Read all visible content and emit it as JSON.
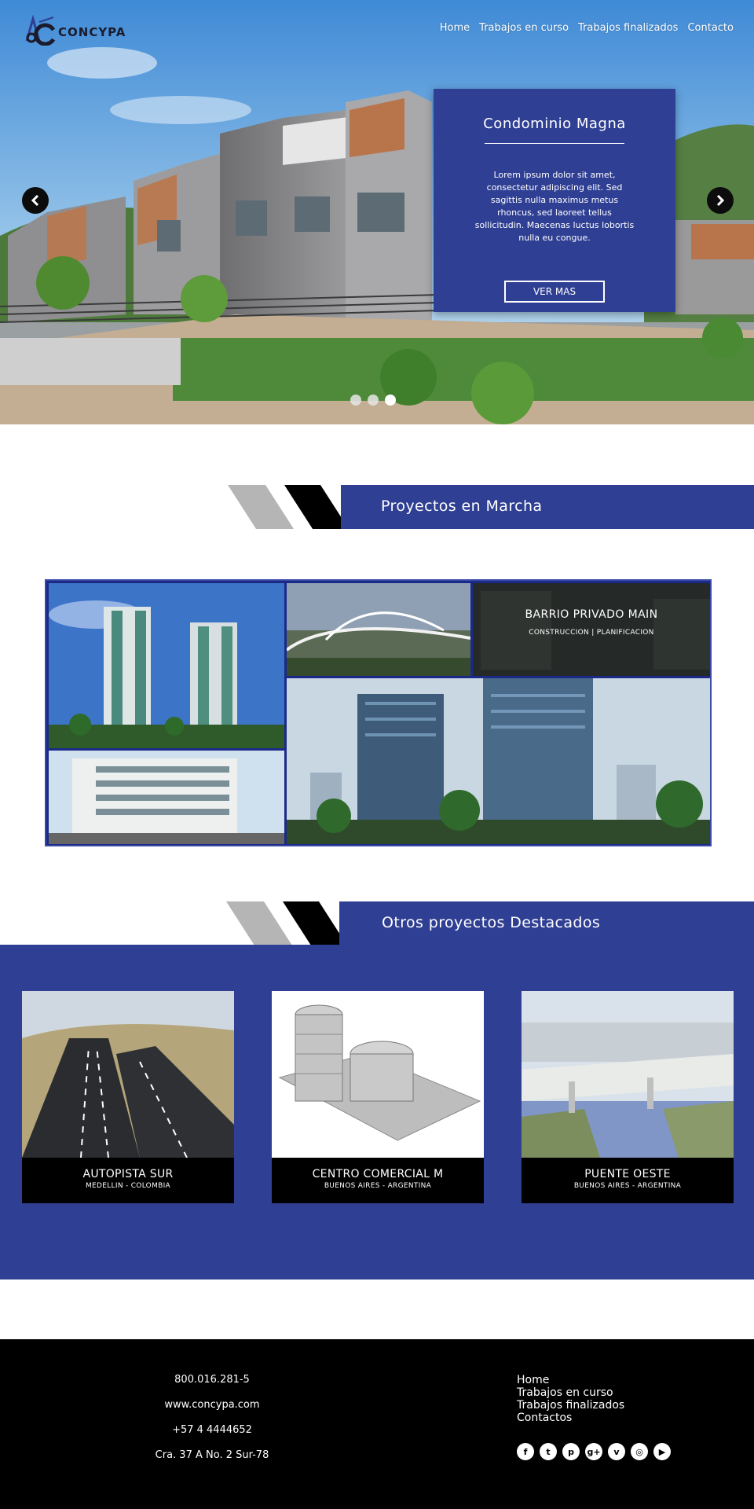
{
  "brand": {
    "name": "CONCYPA"
  },
  "nav": [
    "Home",
    "Trabajos en curso",
    "Trabajos finalizados",
    "Contacto"
  ],
  "hero": {
    "title": "Condominio Magna",
    "text": "Lorem ipsum dolor sit amet, consectetur adipiscing elit. Sed sagittis nulla maximus metus rhoncus, sed laoreet tellus sollicitudin. Maecenas luctus lobortis nulla eu congue.",
    "button": "VER MAS",
    "prev_icon": "chevron-left-icon",
    "next_icon": "chevron-right-icon",
    "slides": 3,
    "active_slide": 3
  },
  "section_running": {
    "title": "Proyectos en Marcha",
    "featured": {
      "title": "BARRIO PRIVADO MAIN",
      "subtitle": "CONSTRUCCION | PLANIFICACION"
    }
  },
  "section_others": {
    "title": "Otros proyectos Destacados",
    "cards": [
      {
        "title": "AUTOPISTA SUR",
        "subtitle": "MEDELLIN - COLOMBIA"
      },
      {
        "title": "CENTRO COMERCIAL M",
        "subtitle": "BUENOS AIRES - ARGENTINA"
      },
      {
        "title": "PUENTE OESTE",
        "subtitle": "BUENOS AIRES - ARGENTINA"
      }
    ]
  },
  "footer": {
    "contact": [
      "800.016.281-5",
      "www.concypa.com",
      "+57 4 4444652",
      "Cra. 37 A No. 2 Sur-78"
    ],
    "nav": [
      "Home",
      "Trabajos en curso",
      "Trabajos finalizados",
      "Contactos"
    ],
    "social": [
      {
        "icon": "facebook-icon",
        "glyph": "f"
      },
      {
        "icon": "twitter-icon",
        "glyph": "t"
      },
      {
        "icon": "pinterest-icon",
        "glyph": "p"
      },
      {
        "icon": "google-plus-icon",
        "glyph": "g+"
      },
      {
        "icon": "vimeo-icon",
        "glyph": "v"
      },
      {
        "icon": "instagram-icon",
        "glyph": "◎"
      },
      {
        "icon": "youtube-icon",
        "glyph": "▶"
      }
    ]
  },
  "colors": {
    "primary": "#2f3f93",
    "dark": "#000000",
    "gray": "#b5b5b5"
  }
}
